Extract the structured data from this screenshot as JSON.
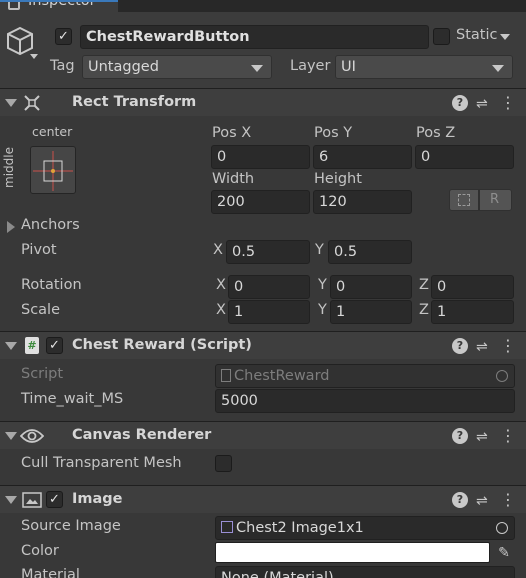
{
  "window": {
    "tab_title": "Inspector"
  },
  "gameobject": {
    "enabled": true,
    "name": "ChestRewardButton",
    "static_label": "Static",
    "tag_label": "Tag",
    "tag_value": "Untagged",
    "layer_label": "Layer",
    "layer_value": "UI"
  },
  "rect_transform": {
    "title": "Rect Transform",
    "anchor_h": "center",
    "anchor_v": "middle",
    "pos_x_label": "Pos X",
    "pos_x": "0",
    "pos_y_label": "Pos Y",
    "pos_y": "6",
    "pos_z_label": "Pos Z",
    "pos_z": "0",
    "width_label": "Width",
    "width": "200",
    "height_label": "Height",
    "height": "120",
    "raw_button": "R",
    "anchors_label": "Anchors",
    "pivot_label": "Pivot",
    "pivot_x_label": "X",
    "pivot_x": "0.5",
    "pivot_y_label": "Y",
    "pivot_y": "0.5",
    "rotation_label": "Rotation",
    "rot_x_label": "X",
    "rot_x": "0",
    "rot_y_label": "Y",
    "rot_y": "0",
    "rot_z_label": "Z",
    "rot_z": "0",
    "scale_label": "Scale",
    "scale_x_label": "X",
    "scale_x": "1",
    "scale_y_label": "Y",
    "scale_y": "1",
    "scale_z_label": "Z",
    "scale_z": "1"
  },
  "chest_reward": {
    "title": "Chest Reward (Script)",
    "enabled": true,
    "script_label": "Script",
    "script_value": "ChestReward",
    "time_label": "Time_wait_MS",
    "time_value": "5000"
  },
  "canvas_renderer": {
    "title": "Canvas Renderer",
    "cull_label": "Cull Transparent Mesh",
    "cull_checked": false
  },
  "image": {
    "title": "Image",
    "enabled": true,
    "source_label": "Source Image",
    "source_value": "Chest2 Image1x1",
    "color_label": "Color",
    "color_value": "#ffffff",
    "material_label": "Material",
    "material_value": "None (Material)"
  },
  "colors": {
    "accent": "#3a79bb",
    "panel": "#383838",
    "field": "#2a2a2a",
    "header": "#3e3e3e"
  }
}
